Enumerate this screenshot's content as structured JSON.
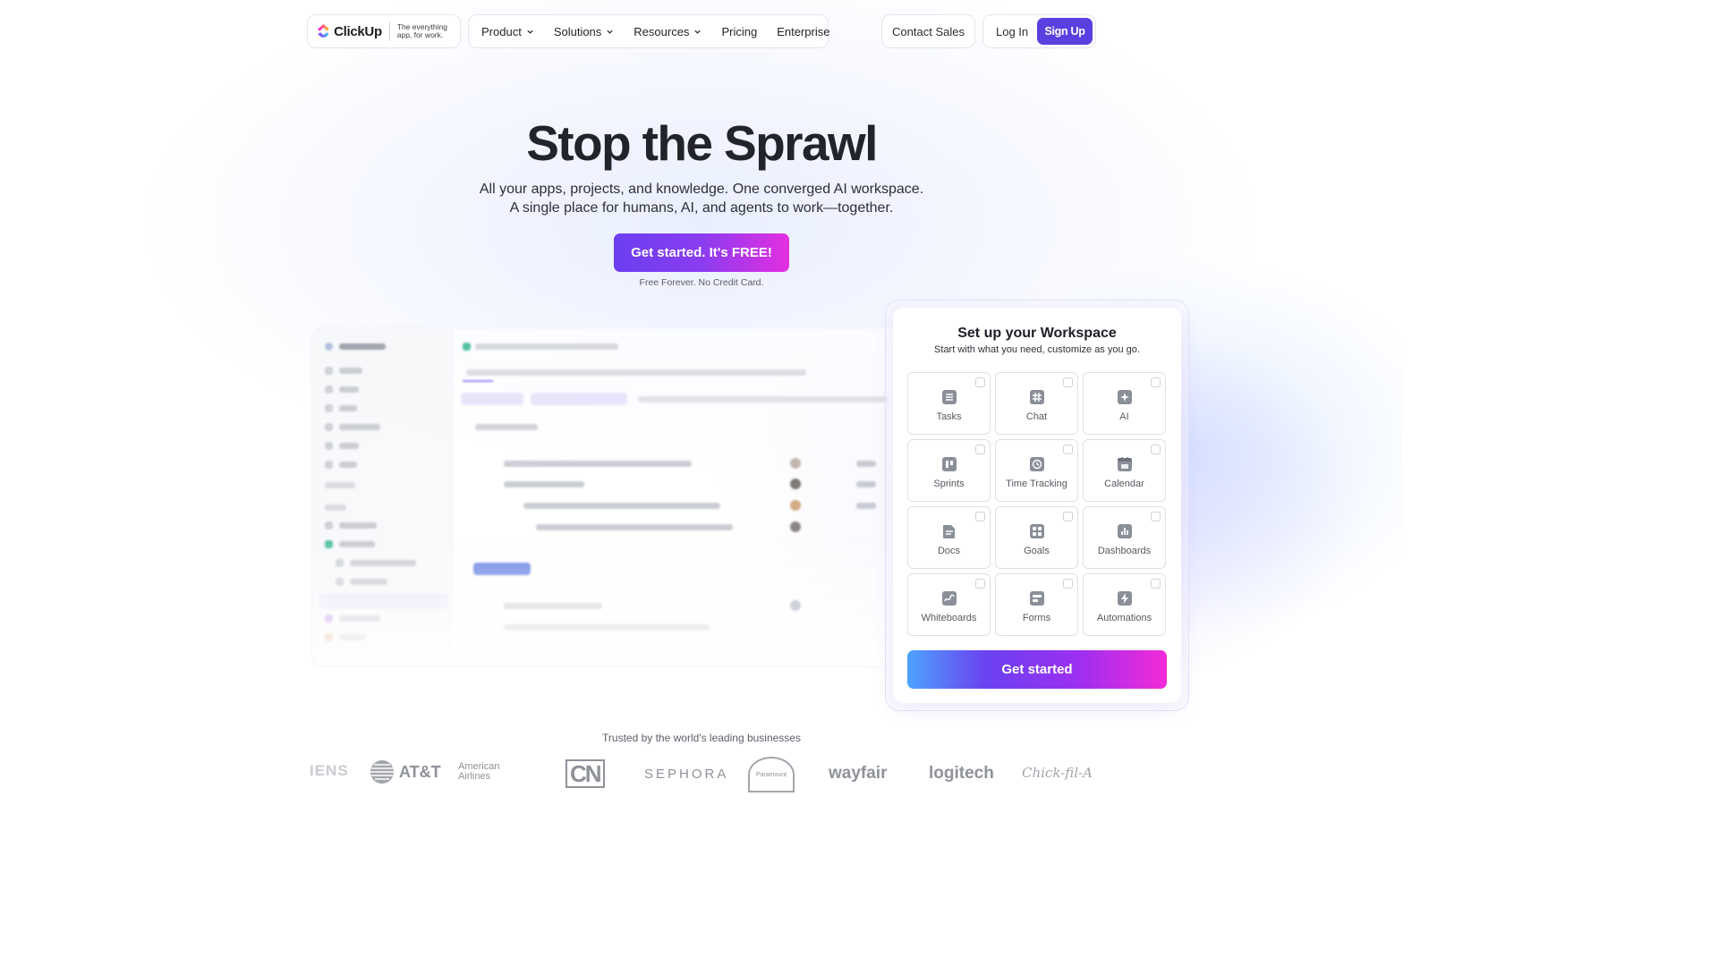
{
  "nav": {
    "logo": {
      "name": "ClickUp",
      "tagline": "The everything app, for work."
    },
    "menu": [
      {
        "label": "Product",
        "has_dropdown": true
      },
      {
        "label": "Solutions",
        "has_dropdown": true
      },
      {
        "label": "Resources",
        "has_dropdown": true
      },
      {
        "label": "Pricing",
        "has_dropdown": false
      },
      {
        "label": "Enterprise",
        "has_dropdown": false
      }
    ],
    "contact_sales": "Contact Sales",
    "log_in": "Log In",
    "sign_up": "Sign Up"
  },
  "hero": {
    "title": "Stop the Sprawl",
    "subtitle_line1": "All your apps, projects, and knowledge. One converged AI workspace.",
    "subtitle_line2": "A single place for humans, AI, and agents to work—together.",
    "cta": "Get started. It's FREE!",
    "cta_note": "Free Forever. No Credit Card."
  },
  "workspace_setup": {
    "title": "Set up your Workspace",
    "subtitle": "Start with what you need, customize as you go.",
    "options": [
      {
        "label": "Tasks",
        "icon": "list-icon"
      },
      {
        "label": "Chat",
        "icon": "hash-icon"
      },
      {
        "label": "AI",
        "icon": "sparkle-icon"
      },
      {
        "label": "Sprints",
        "icon": "sprint-icon"
      },
      {
        "label": "Time Tracking",
        "icon": "clock-icon"
      },
      {
        "label": "Calendar",
        "icon": "calendar-icon"
      },
      {
        "label": "Docs",
        "icon": "doc-icon"
      },
      {
        "label": "Goals",
        "icon": "grid-icon"
      },
      {
        "label": "Dashboards",
        "icon": "chart-icon"
      },
      {
        "label": "Whiteboards",
        "icon": "whiteboard-icon"
      },
      {
        "label": "Forms",
        "icon": "form-icon"
      },
      {
        "label": "Automations",
        "icon": "bolt-icon"
      }
    ],
    "submit": "Get started"
  },
  "trusted": {
    "heading": "Trusted by the world's leading businesses",
    "brands": [
      "IENS",
      "AT&T",
      "American Airlines",
      "CN",
      "SEPHORA",
      "Paramount",
      "wayfair",
      "logitech",
      "Chick-fil-A"
    ]
  },
  "colors": {
    "accent": "#5b3fe0",
    "cta_gradient_start": "#6a3ff0",
    "cta_gradient_end": "#e32fe0",
    "logo_text": "#1d1d24"
  }
}
